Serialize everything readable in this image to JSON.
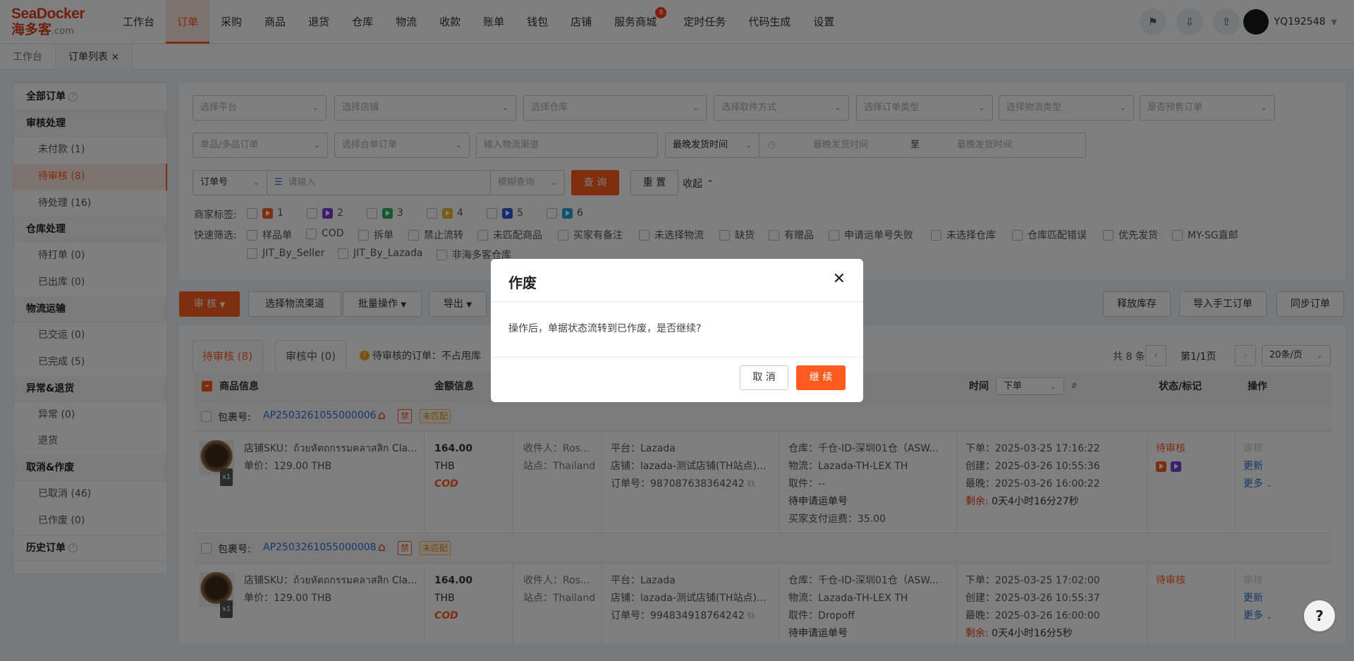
{
  "logo": {
    "brand": "SeaDocker",
    "cn": "海多客",
    "suffix": ".com"
  },
  "nav": [
    "工作台",
    "订单",
    "采购",
    "商品",
    "退货",
    "仓库",
    "物流",
    "收款",
    "账单",
    "钱包",
    "店铺",
    "服务商城",
    "定时任务",
    "代码生成",
    "设置"
  ],
  "nav_badge": "8",
  "user": {
    "name": "YQ192548"
  },
  "page_tabs": [
    "工作台",
    "订单列表 ×"
  ],
  "sidebar": {
    "all_orders": "全部订单",
    "groups": [
      {
        "title": "审核处理",
        "items": [
          "未付款 (1)",
          "待审核 (8)",
          "待处理 (16)"
        ]
      },
      {
        "title": "仓库处理",
        "items": [
          "待打单 (0)",
          "已出库 (0)"
        ]
      },
      {
        "title": "物流运输",
        "items": [
          "已交运 (0)",
          "已完成 (5)"
        ]
      },
      {
        "title": "异常&退货",
        "items": [
          "异常 (0)",
          "退货"
        ]
      },
      {
        "title": "取消&作废",
        "items": [
          "已取消 (46)",
          "已作废 (0)"
        ]
      }
    ],
    "history": "历史订单"
  },
  "filters": {
    "row1": [
      "选择平台",
      "选择店铺",
      "选择仓库",
      "选择取件方式",
      "选择订单类型",
      "选择物流类型",
      "是否预售订单"
    ],
    "row2_select1": "单品/多品订单",
    "row2_select2": "选择合单订单",
    "row2_input": "输入物流渠道",
    "time_type": "最晚发货时间",
    "time_start": "最晚发货时间",
    "time_to": "至",
    "time_end": "最晚发货时间",
    "order_no": "订单号",
    "search_placeholder": "请输入",
    "fuzzy": "模糊查询",
    "query": "查 询",
    "reset": "重 置",
    "collapse": "收起",
    "merchant_tags_label": "商家标签:",
    "merchant_tags": [
      "1",
      "2",
      "3",
      "4",
      "5",
      "6"
    ],
    "tag_colors": [
      "#ff5a1f",
      "#7a3fe0",
      "#29b35c",
      "#f5b824",
      "#2a55e0",
      "#27a3e0"
    ],
    "quick_label": "快速筛选:",
    "quick_filters": [
      "样品单",
      "COD",
      "拆单",
      "禁止流转",
      "未匹配商品",
      "买家有备注",
      "未选择物流",
      "缺货",
      "有赠品",
      "申请运单号失败",
      "未选择仓库",
      "仓库匹配错误",
      "优先发货",
      "MY-SG直邮",
      "JIT_By_Seller",
      "JIT_By_Lazada",
      "非海多客仓库"
    ]
  },
  "actions": {
    "audit": "审 核",
    "select_channel": "选择物流渠道",
    "batch": "批量操作",
    "export": "导出",
    "release": "释放库存",
    "import": "导入手工订单",
    "sync": "同步订单"
  },
  "table": {
    "tab_pending": "待审核 (8)",
    "tab_reviewing": "审核中 (0)",
    "notice": "待审核的订单：不占用库",
    "total": "共 8 条",
    "page": "第1/1页",
    "page_size": "20条/页",
    "headers": {
      "product": "商品信息",
      "amount": "金额信息",
      "time": "时间",
      "time_sort": "下单",
      "status": "状态/标记",
      "ops": "操作"
    },
    "rows": [
      {
        "pkg_label": "包裹号:",
        "pkg_no": "AP2503261055000006",
        "tag_ban": "禁",
        "tag_unmatched": "未匹配",
        "sku": "店铺SKU：ถ้วยหัตถกรรมคลาสสิก Cla...",
        "price": "单价：129.00 THB",
        "qty": "x1",
        "amount": "164.00",
        "currency": "THB",
        "cod": "COD",
        "receiver": "收件人：Ros...",
        "site": "站点：Thailand",
        "platform": "平台：Lazada",
        "store": "店铺：lazada-测试店铺(TH站点)...",
        "order_no": "订单号：987087638364242",
        "warehouse": "仓库：千仓-ID-深圳01仓（ASW...",
        "logistics": "物流：Lazada-TH-LEX TH",
        "pickup": "取件：--",
        "waybill": "待申请运单号",
        "freight": "买家支付运费：35.00",
        "t_order": "下单：2025-03-25 17:16:22",
        "t_create": "创建：2025-03-26 10:55:36",
        "t_latest": "最晚：2025-03-26 16:00:22",
        "remain_label": "剩余:",
        "remain": "0天4小时16分27秒",
        "status": "待审核",
        "op_audit": "审核",
        "op_update": "更新",
        "op_more": "更多"
      },
      {
        "pkg_label": "包裹号:",
        "pkg_no": "AP2503261055000008",
        "tag_ban": "禁",
        "tag_unmatched": "未匹配",
        "sku": "店铺SKU：ถ้วยหัตถกรรมคลาสสิก Cla...",
        "price": "单价：129.00 THB",
        "qty": "x1",
        "amount": "164.00",
        "currency": "THB",
        "cod": "COD",
        "receiver": "收件人：Ros...",
        "site": "站点：Thailand",
        "platform": "平台：Lazada",
        "store": "店铺：lazada-测试店铺(TH站点)...",
        "order_no": "订单号：994834918764242",
        "warehouse": "仓库：千仓-ID-深圳01仓（ASW...",
        "logistics": "物流：Lazada-TH-LEX TH",
        "pickup": "取件：Dropoff",
        "waybill": "待申请运单号",
        "t_order": "下单：2025-03-25 17:02:00",
        "t_create": "创建：2025-03-26 10:55:37",
        "t_latest": "最晚：2025-03-26 16:00:00",
        "remain_label": "剩余:",
        "remain": "0天4小时16分5秒",
        "status": "待审核",
        "op_audit": "审核",
        "op_update": "更新",
        "op_more": "更多"
      }
    ]
  },
  "modal": {
    "title": "作废",
    "message": "操作后，单据状态流转到已作废，是否继续?",
    "cancel": "取 消",
    "confirm": "继 续"
  },
  "help": "?",
  "colors": {
    "accent": "#ff5a1f",
    "link": "#2a6fd6"
  }
}
